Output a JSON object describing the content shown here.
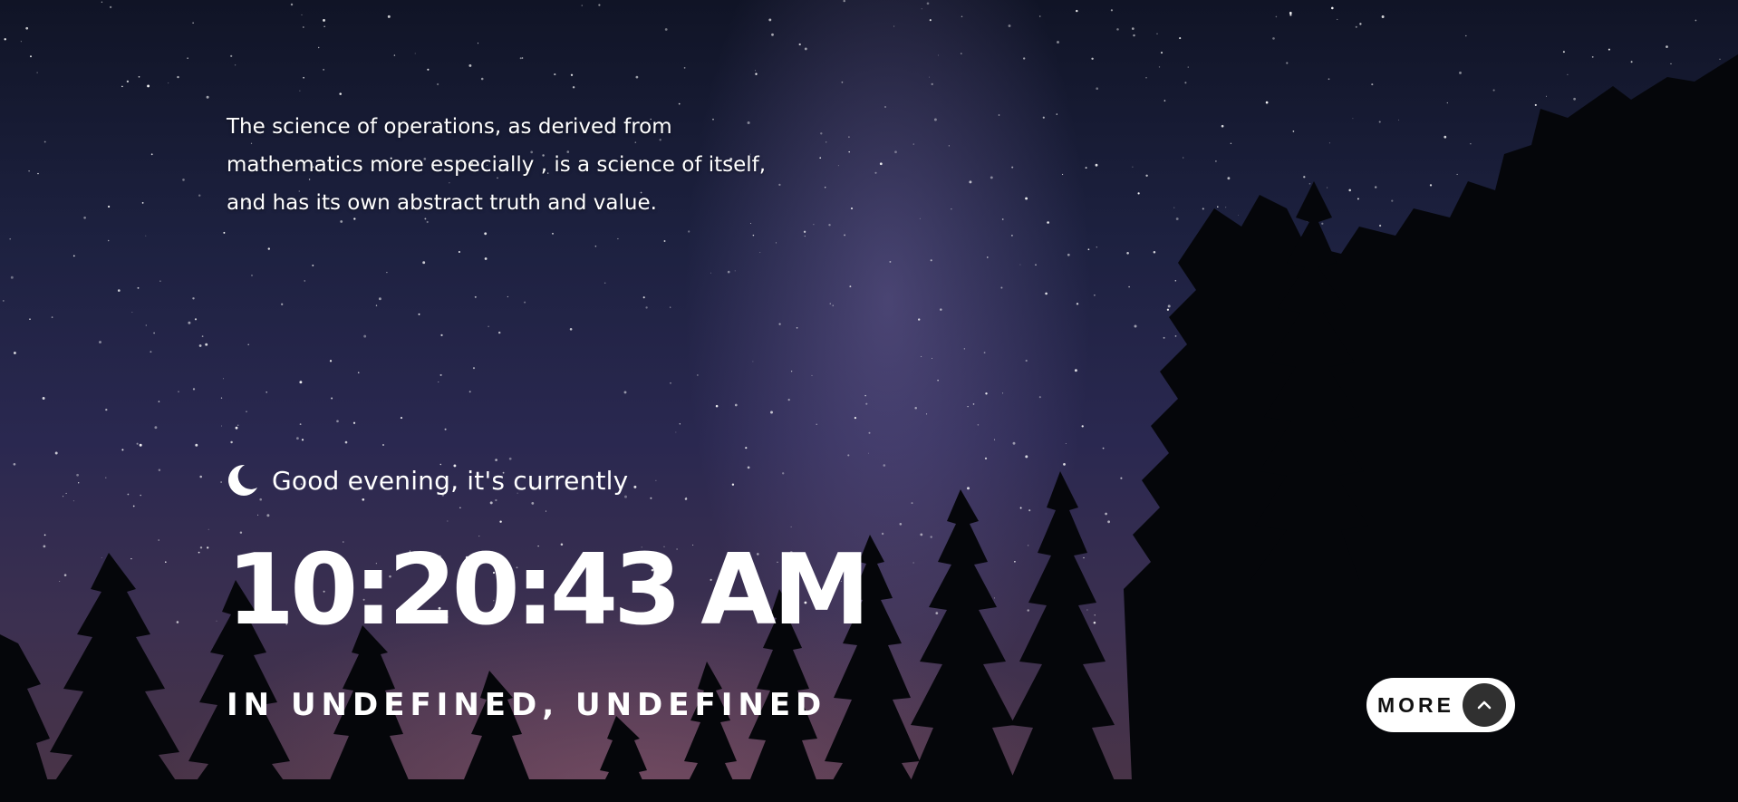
{
  "quote": {
    "text": "The science of operations, as derived from mathematics more especially , is a science of itself, and has its own abstract truth and value."
  },
  "greeting": {
    "icon": "moon-icon",
    "text": "Good evening, it's currently"
  },
  "clock": {
    "time": "10:20:43",
    "period": "AM"
  },
  "location": {
    "text": "IN UNDEFINED, UNDEFINED"
  },
  "more_button": {
    "label": "MORE",
    "icon": "chevron-up-icon"
  },
  "colors": {
    "text": "#ffffff",
    "button_bg": "#ffffff",
    "button_icon_bg": "#303030"
  }
}
